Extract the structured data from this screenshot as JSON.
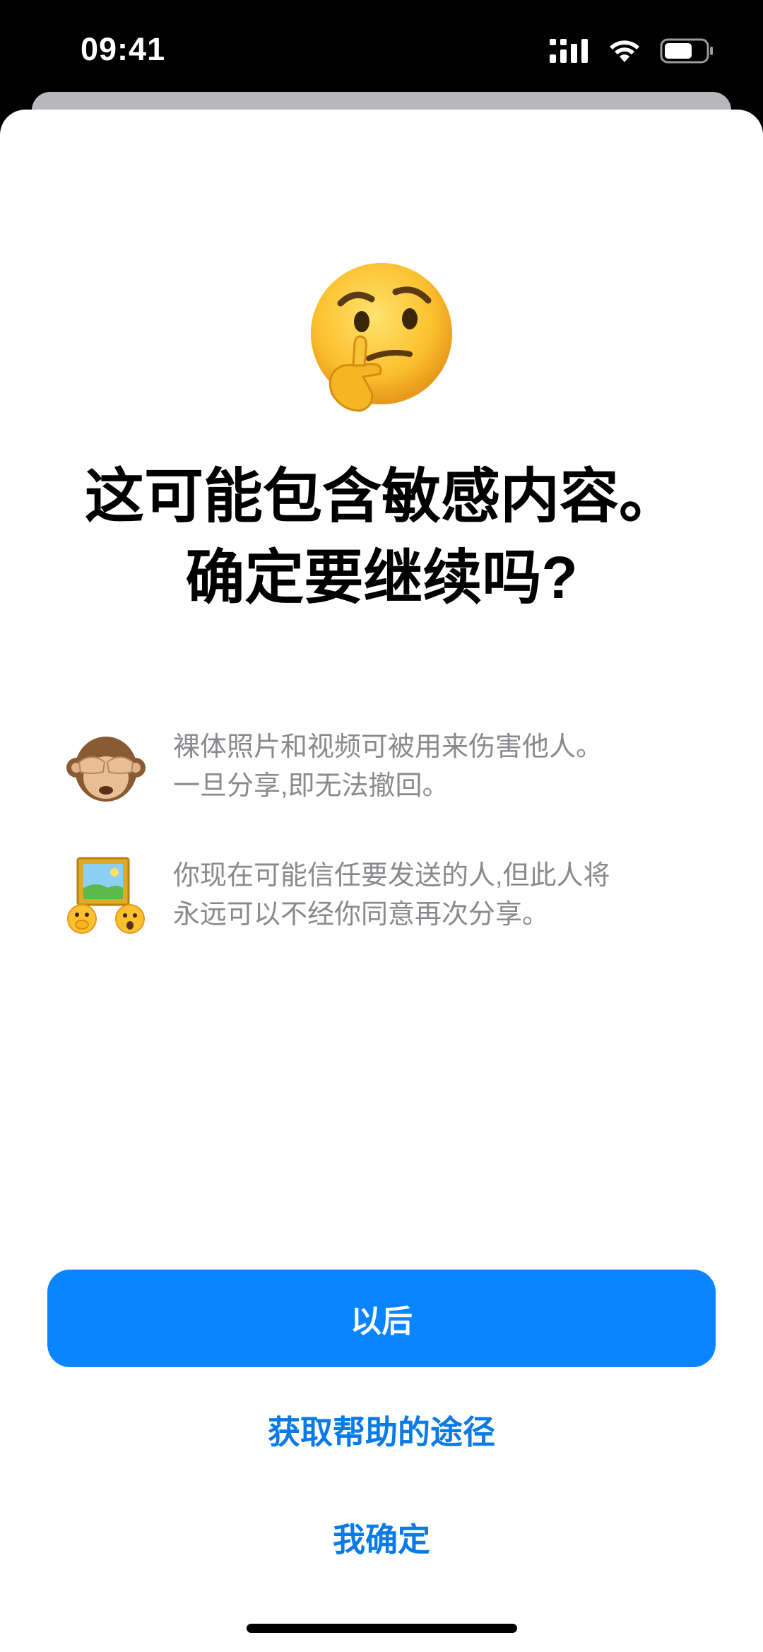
{
  "status_bar": {
    "time": "09:41",
    "icons": [
      "cellular-signal-icon",
      "wifi-icon",
      "battery-icon"
    ]
  },
  "sheet": {
    "hero_icon": "thinking-face-emoji-icon",
    "title_lines": [
      "这可能包含敏感内容。",
      "确定要继续吗?"
    ],
    "info_items": [
      {
        "icon": "see-no-evil-monkey-emoji-icon",
        "lines": [
          "裸体照片和视频可被用来伤害他人。",
          "一旦分享,即无法撤回。"
        ]
      },
      {
        "icon": "framed-picture-with-faces-emoji-icon",
        "lines": [
          "你现在可能信任要发送的人,但此人将",
          "永远可以不经你同意再次分享。"
        ]
      }
    ],
    "primary_button_label": "以后",
    "help_link_label": "获取帮助的途径",
    "confirm_label": "我确定"
  },
  "colors": {
    "accent": "#0a84ff",
    "link": "#0a7ae6",
    "secondary_text": "#8a8a8e"
  }
}
